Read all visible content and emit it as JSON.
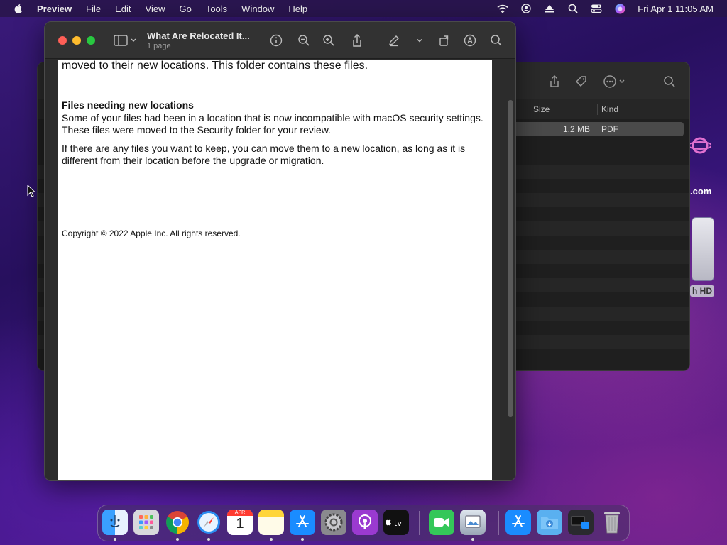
{
  "menubar": {
    "app": "Preview",
    "items": [
      "File",
      "Edit",
      "View",
      "Go",
      "Tools",
      "Window",
      "Help"
    ],
    "clock": "Fri Apr 1  11:05 AM"
  },
  "preview": {
    "title": "What Are Relocated It...",
    "subtitle": "1 page",
    "doc": {
      "lead": "moved to their new locations. This folder contains these files.",
      "heading": "Files needing new locations",
      "para1": "Some of your files had been in a location that is now incompatible with macOS security settings. These files were moved to the Security folder for your review.",
      "para2": "If there are any files you want to keep, you can move them to a new location, as long as it is different from their location before the upgrade or migration.",
      "copyright": "Copyright © 2022 Apple Inc. All rights reserved."
    }
  },
  "finder": {
    "columns": [
      "Size",
      "Kind"
    ],
    "row": {
      "size": "1.2 MB",
      "kind": "PDF"
    }
  },
  "desktop": {
    "partial_label_1": ".com",
    "partial_label_2": "h HD"
  },
  "dock": {
    "calendar_month": "APR",
    "calendar_day": "1"
  },
  "colors": {
    "close": "#ff5f57",
    "minimize": "#febc2e",
    "zoom": "#28c840"
  }
}
